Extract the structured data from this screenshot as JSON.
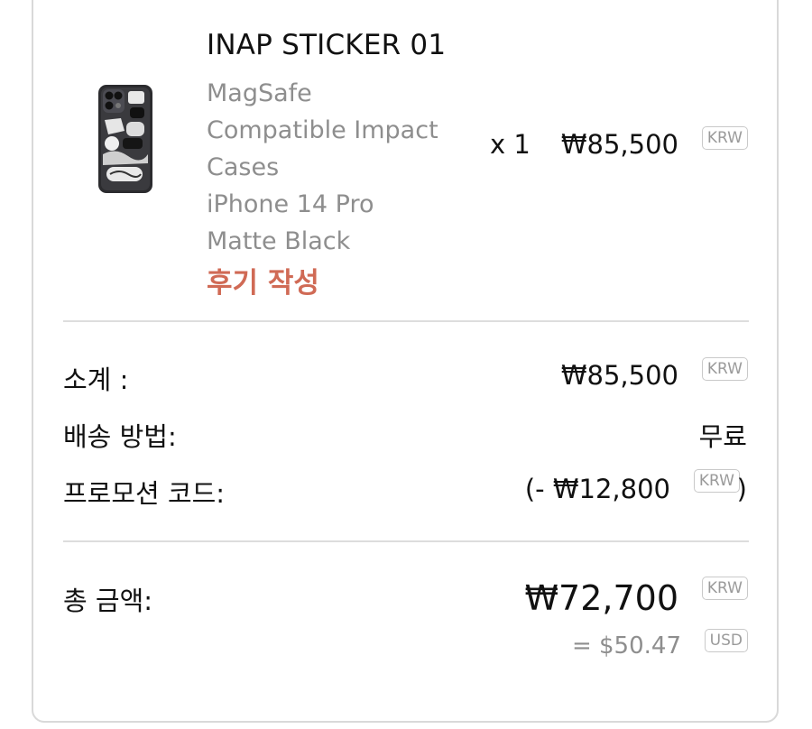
{
  "product": {
    "name": "INAP STICKER 01",
    "variant_lines": [
      "MagSafe",
      "Compatible Impact",
      "Cases",
      "iPhone 14 Pro",
      "Matte Black"
    ],
    "review_link": "후기 작성",
    "quantity": "x 1",
    "price": "₩85,500",
    "currency": "KRW",
    "thumbnail_icon": "phone-case-icon"
  },
  "summary": {
    "subtotal_label": "소계 :",
    "subtotal_value": "₩85,500",
    "subtotal_currency": "KRW",
    "shipping_label": "배송 방법:",
    "shipping_value": "무료",
    "promo_label": "프로모션 코드:",
    "promo_prefix": "(- ₩12,800",
    "promo_currency": "KRW",
    "promo_suffix": ")"
  },
  "total": {
    "label": "총 금액:",
    "value": "₩72,700",
    "currency": "KRW",
    "usd_value": "= $50.47",
    "usd_currency": "USD"
  },
  "colors": {
    "review_accent": "#d06a55",
    "muted_text": "#8e8e8e",
    "divider": "#dddddd"
  }
}
